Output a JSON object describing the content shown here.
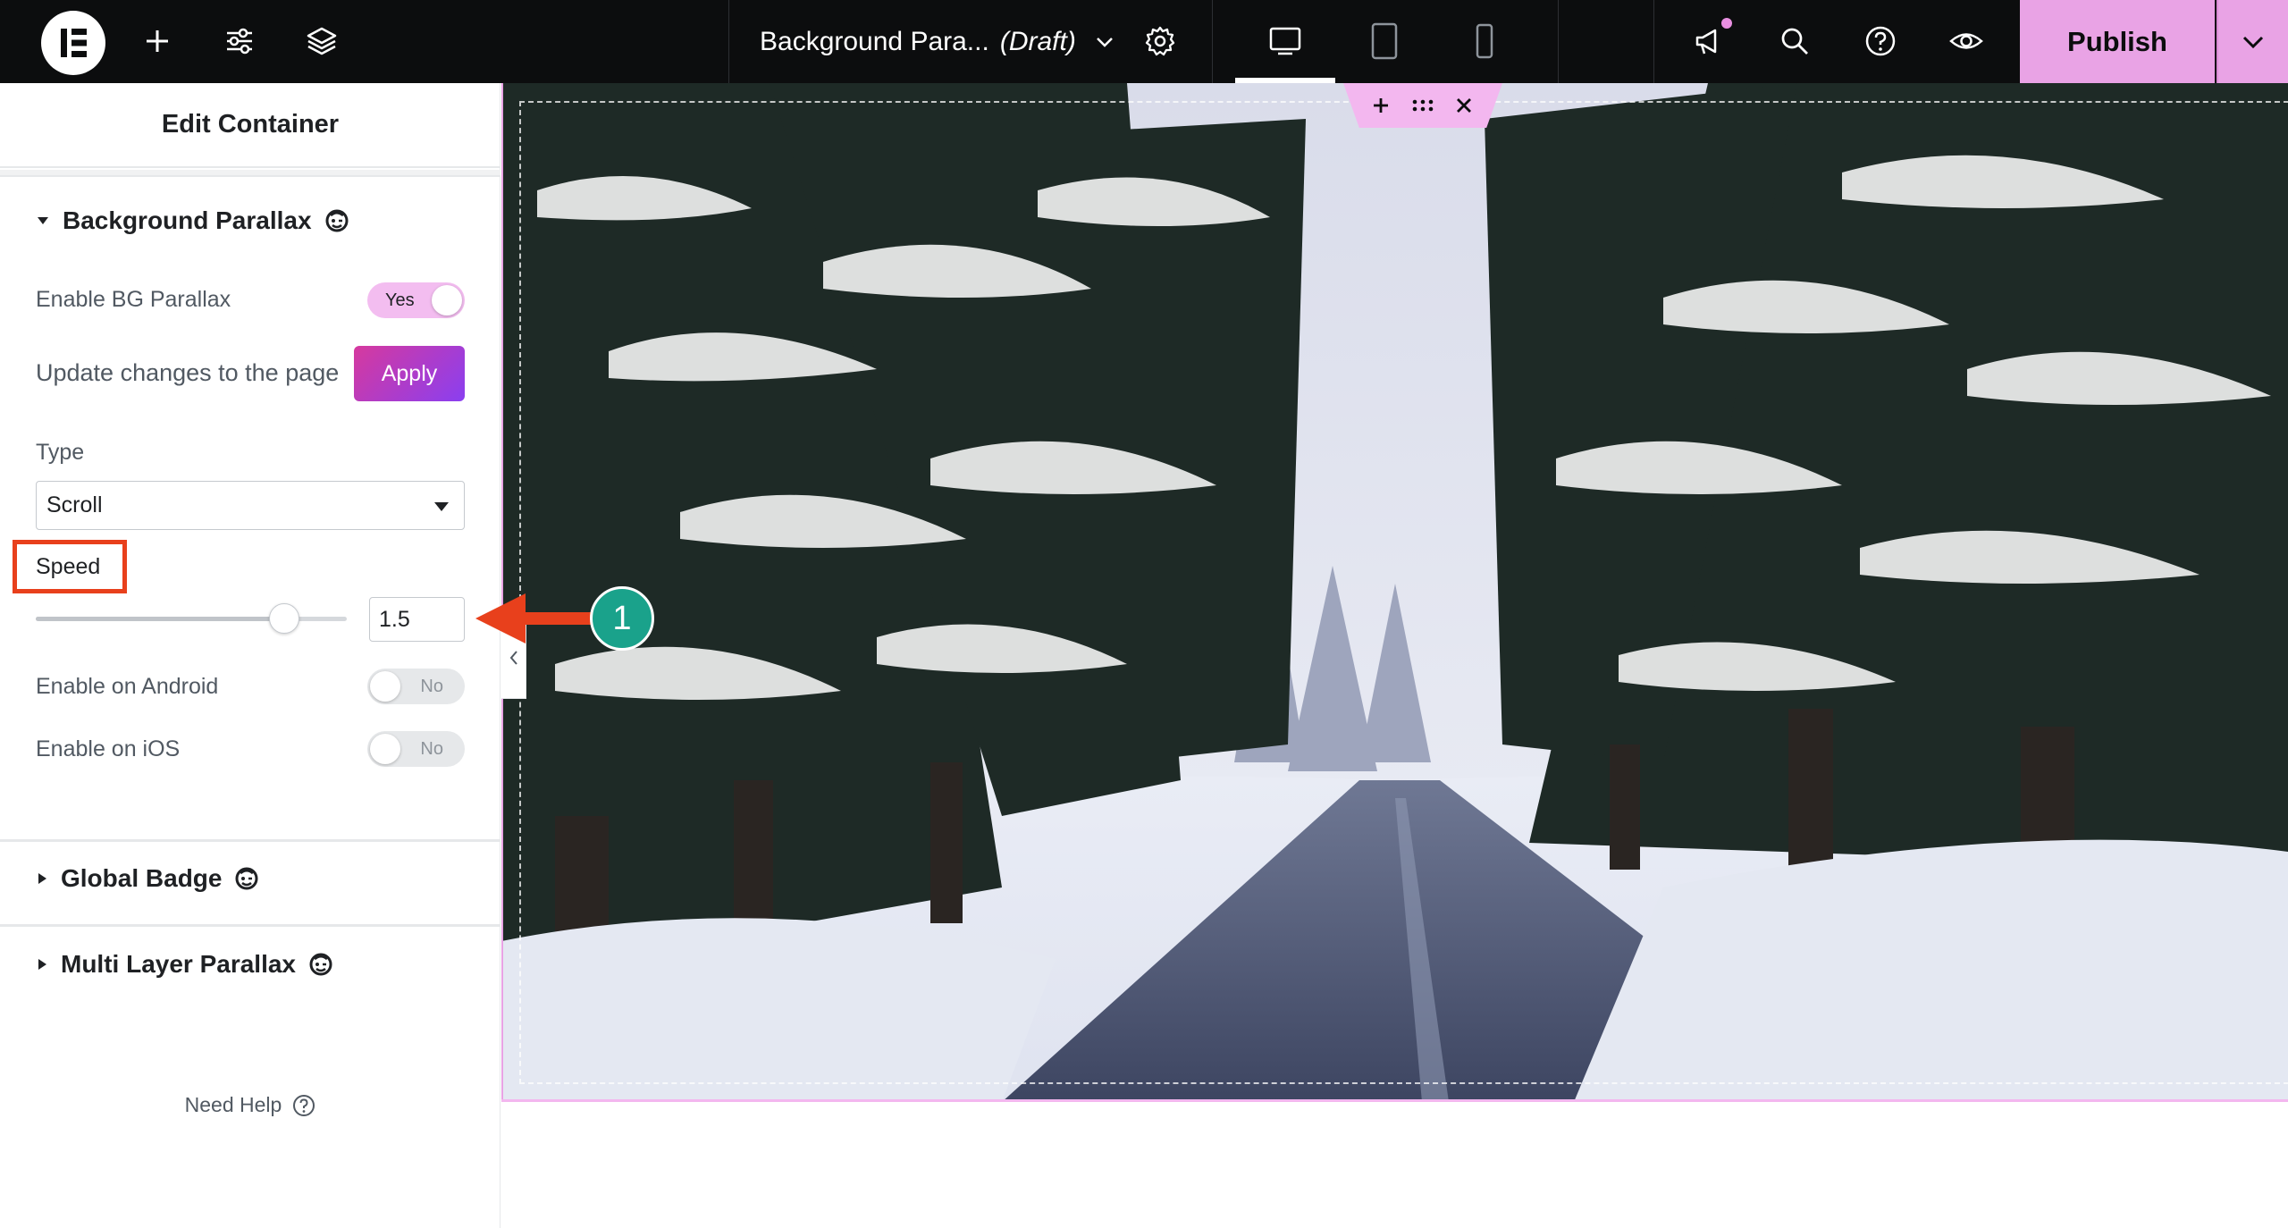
{
  "topbar": {
    "doc_title": "Background Para...",
    "doc_status": "(Draft)",
    "publish_label": "Publish",
    "icons": [
      "elementor-logo",
      "add-icon",
      "site-settings-icon",
      "structure-icon",
      "page-settings-icon",
      "desktop-icon",
      "tablet-icon",
      "mobile-icon",
      "notifications-icon",
      "search-icon",
      "help-icon",
      "preview-icon",
      "chevron-down-icon"
    ],
    "active_device": "desktop",
    "accent_color": "#e9a3e5"
  },
  "panel": {
    "title": "Edit Container",
    "sections": [
      {
        "title": "Background Parallax",
        "expanded": true,
        "controls": {
          "enable_bg_parallax": {
            "label": "Enable BG Parallax",
            "value": "Yes"
          },
          "update_changes": {
            "label": "Update changes to the page",
            "button": "Apply"
          },
          "type": {
            "label": "Type",
            "value": "Scroll"
          },
          "speed": {
            "label": "Speed",
            "value": "1.5",
            "slider_fraction": 0.8
          },
          "enable_android": {
            "label": "Enable on Android",
            "value": "No"
          },
          "enable_ios": {
            "label": "Enable on iOS",
            "value": "No"
          }
        }
      },
      {
        "title": "Global Badge",
        "expanded": false
      },
      {
        "title": "Multi Layer Parallax",
        "expanded": false
      }
    ],
    "need_help": "Need Help"
  },
  "annotation": {
    "number": "1",
    "color": "#1aa28b",
    "arrow_color": "#e8401c"
  }
}
